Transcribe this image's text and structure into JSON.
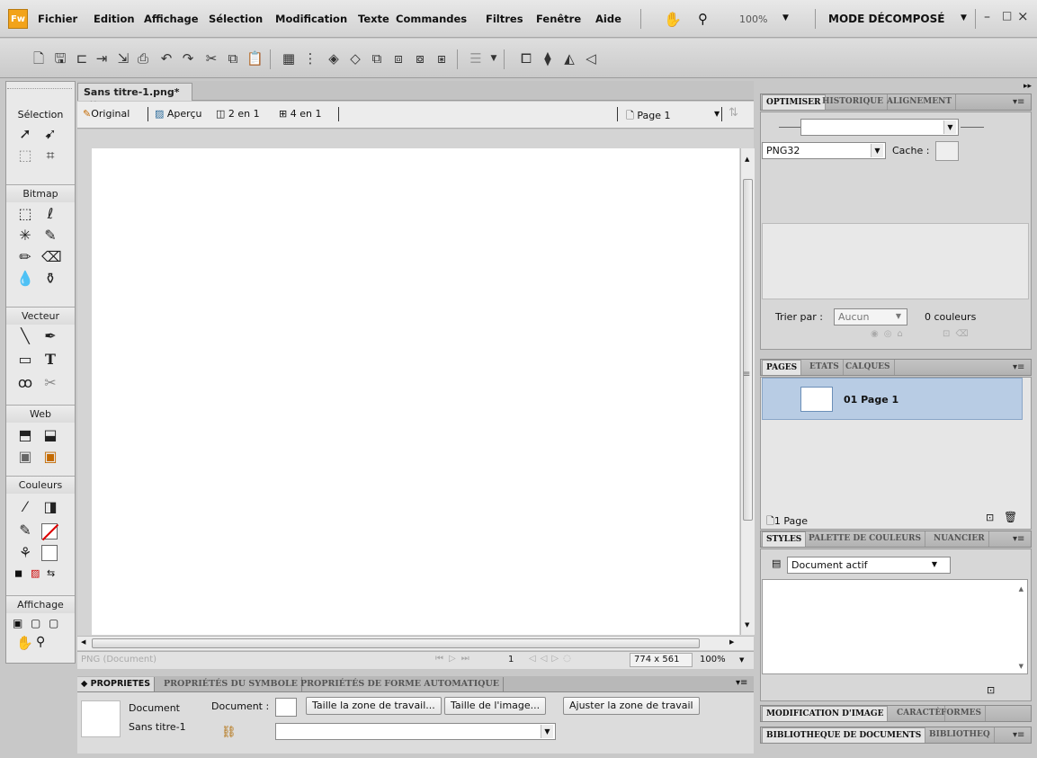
{
  "app": {
    "logo": "Fw"
  },
  "menu": [
    "Fichier",
    "Edition",
    "Affichage",
    "Sélection",
    "Modification",
    "Texte",
    "Commandes",
    "Filtres",
    "Fenêtre",
    "Aide"
  ],
  "zoom": "100%",
  "workspace_mode": "MODE DÉCOMPOSÉ",
  "window_controls": {
    "minimize": "–",
    "maximize": "□",
    "close": "×"
  },
  "doc_tab": {
    "title": "Sans titre-1.png*",
    "close": "×"
  },
  "view_tabs": {
    "original": "Original",
    "apercu": "Aperçu",
    "two_up": "2 en 1",
    "four_up": "4 en 1"
  },
  "page_select": "Page 1",
  "left_panel": {
    "selection": "Sélection",
    "bitmap": "Bitmap",
    "vecteur": "Vecteur",
    "web": "Web",
    "couleurs": "Couleurs",
    "affichage": "Affichage"
  },
  "status": {
    "format": "PNG (Document)",
    "frame": "1",
    "size": "774 x 561",
    "zoom": "100%"
  },
  "props": {
    "tabs": [
      "PROPRIETES",
      "PROPRIÉTÉS DU SYMBOLE",
      "PROPRIÉTÉS DE FORME AUTOMATIQUE"
    ],
    "doc_label": "Document",
    "doc_name": "Sans titre-1",
    "doc_field": "Document :",
    "btn_canvas": "Taille la zone de travail...",
    "btn_image": "Taille de l'image...",
    "btn_fit": "Ajuster la zone de travail"
  },
  "optimize": {
    "tabs": [
      "OPTIMISER",
      "HISTORIQUE",
      "ALIGNEMENT"
    ],
    "format": "PNG32",
    "cache": "Cache :",
    "sort_label": "Trier par :",
    "sort_value": "Aucun",
    "colors": "0 couleurs"
  },
  "pages": {
    "tabs": [
      "PAGES",
      "ETATS",
      "CALQUES"
    ],
    "page_item": "01  Page 1",
    "count": "1 Page"
  },
  "styles": {
    "tabs": [
      "STYLES",
      "PALETTE DE COULEURS",
      "NUANCIER"
    ],
    "library": "Document actif"
  },
  "bottom_panels": {
    "row1": [
      "MODIFICATION D'IMAGE",
      "CARACTÈ",
      "FORMES"
    ],
    "row2": [
      "BIBLIOTHEQUE DE DOCUMENTS",
      "BIBLIOTHEQ"
    ]
  },
  "colors": {
    "accent": "#f2a31a",
    "selection": "#b8cce4"
  }
}
